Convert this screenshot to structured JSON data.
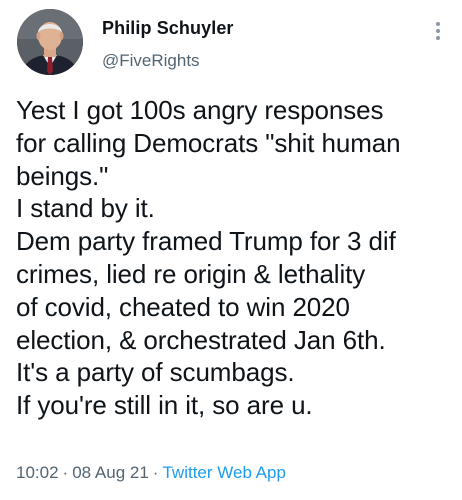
{
  "author": {
    "display_name": "Philip Schuyler",
    "handle": "@FiveRights",
    "avatar_icon": "profile-photo-man-in-suit"
  },
  "more_icon": "vertical-dots-more-icon",
  "tweet": {
    "lines": [
      "Yest I got 100s angry responses",
      "for calling Democrats \"shit human",
      "beings.\"",
      "I stand by it.",
      "Dem party framed Trump for 3 dif",
      "crimes, lied re origin & lethality",
      "of covid, cheated to win 2020",
      "election, & orchestrated Jan 6th.",
      "It's a party of scumbags.",
      "If you're still in it, so are u."
    ]
  },
  "meta": {
    "time": "10:02",
    "separator": "·",
    "date": "08 Aug 21",
    "source": "Twitter Web App"
  },
  "colors": {
    "text": "#0f1419",
    "secondary": "#536471",
    "link": "#1d9bf0"
  }
}
